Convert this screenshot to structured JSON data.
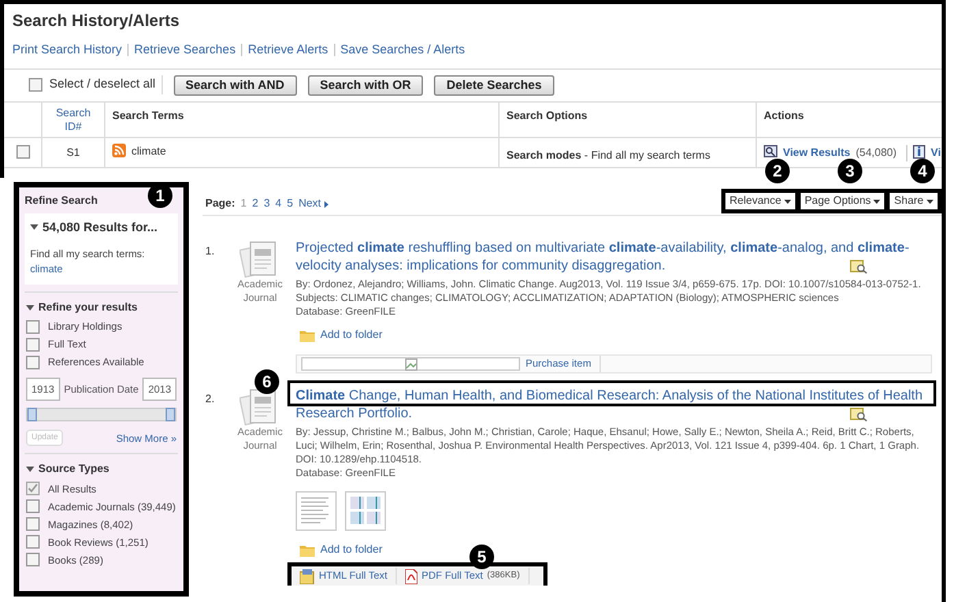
{
  "header": {
    "title": "Search History/Alerts",
    "links": [
      "Print Search History",
      "Retrieve Searches",
      "Retrieve Alerts",
      "Save Searches / Alerts"
    ],
    "select_all": {
      "label": "Select / deselect all",
      "checked": false
    },
    "buttons": [
      "Search with AND",
      "Search with OR",
      "Delete Searches"
    ],
    "table": {
      "columns": [
        "Search ID#",
        "Search Terms",
        "Search Options",
        "Actions"
      ],
      "rows": [
        {
          "checked": false,
          "id": "S1",
          "term": "climate",
          "options": "**Search modes** - Find all my search terms",
          "view_results": "View Results",
          "count": "(54,080)",
          "action_2": "Vi"
        }
      ]
    }
  },
  "refine": {
    "title": "Refine Search",
    "callout": "1",
    "results_for": {
      "label": "54,080 Results for...",
      "expanded": true,
      "text": "Find all my search terms:",
      "term": "climate"
    },
    "refine_results": {
      "label": "Refine your results",
      "expanded": true,
      "options": [
        {
          "label": "Library Holdings",
          "checked": false
        },
        {
          "label": "Full Text",
          "checked": false
        },
        {
          "label": "References Available",
          "checked": false
        }
      ]
    },
    "date": {
      "from": "1913",
      "label": "Publication Date",
      "to": "2013",
      "handles": [
        {
          "level": 0
        },
        {
          "level": 1
        }
      ]
    },
    "update": {
      "label": "Update",
      "disabled": true
    },
    "show_more": "Show More »",
    "source_types": {
      "label": "Source Types",
      "expanded": true,
      "options": [
        {
          "label": "All Results",
          "checked": true
        },
        {
          "label": "Academic Journals (39,449)",
          "checked": false
        },
        {
          "label": "Magazines (8,402)",
          "checked": false
        },
        {
          "label": "Book Reviews (1,251)",
          "checked": false
        },
        {
          "label": "Books (289)",
          "checked": false
        }
      ]
    }
  },
  "results_bar": {
    "label": "Page:",
    "pages": [
      {
        "label": "1",
        "selected": true
      },
      {
        "label": "2",
        "selected": false
      },
      {
        "label": "3",
        "selected": false
      },
      {
        "label": "4",
        "selected": false
      },
      {
        "label": "5",
        "selected": false
      }
    ],
    "next": "Next",
    "menus": [
      {
        "label": "Relevance",
        "callout": "2"
      },
      {
        "label": "Page Options",
        "callout": "3"
      },
      {
        "label": "Share",
        "callout": "4"
      }
    ]
  },
  "results": [
    {
      "number": "1.",
      "type": "Academic Journal",
      "title": "Projected **climate** reshuffling based on multivariate **climate**-availability, **climate**-analog, and **climate**-velocity analyses: implications for community disaggregation.",
      "details": [
        "By: Ordonez, Alejandro; Williams, John. Climatic Change. Aug2013, Vol. 119 Issue 3/4, p659-675. 17p. DOI: 10.1007/s10584-013-0752-1.",
        "Subjects: CLIMATIC changes; CLIMATOLOGY; ACCLIMATIZATION; ADAPTATION (Biology); ATMOSPHERIC sciences",
        "Database: GreenFILE"
      ],
      "add_to_folder": "Add to folder",
      "purchase": "Purchase item"
    },
    {
      "number": "2.",
      "type": "Academic Journal",
      "title": "**Climate** Change, Human Health, and Biomedical Research: Analysis of the National Institutes of Health Research Portfolio.",
      "title_callout": "6",
      "details": [
        "By: Jessup, Christine M.; Balbus, John M.; Christian, Carole; Haque, Ehsanul; Howe, Sally E.; Newton, Sheila A.; Reid, Britt C.; Roberts, Luci; Wilhelm, Erin; Rosenthal, Joshua P. Environmental Health Perspectives. Apr2013, Vol. 121 Issue 4, p399-404. 6p. 1 Chart, 1 Graph. DOI: 10.1289/ehp.1104518.",
        "Database: GreenFILE"
      ],
      "thumbnails": [
        {
          "kind": "table"
        },
        {
          "kind": "chart"
        }
      ],
      "add_to_folder": "Add to folder",
      "full_text": {
        "callout": "5",
        "links": [
          {
            "kind": "html",
            "label": "HTML Full Text"
          },
          {
            "kind": "pdf",
            "label": "PDF Full Text",
            "size": "(386KB)"
          }
        ]
      }
    }
  ]
}
